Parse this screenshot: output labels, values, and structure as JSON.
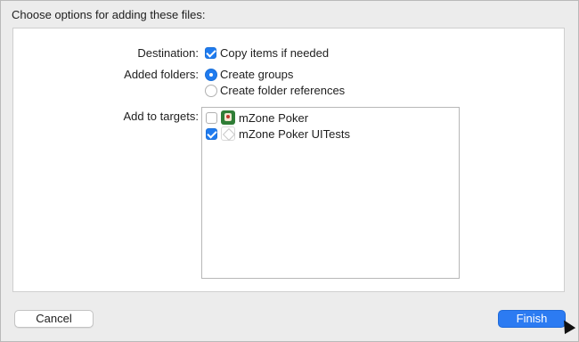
{
  "dialog": {
    "heading": "Choose options for adding these files:"
  },
  "options": {
    "destination": {
      "label": "Destination:",
      "checkbox_label": "Copy items if needed",
      "checked": true
    },
    "added_folders": {
      "label": "Added folders:",
      "choices": [
        {
          "label": "Create groups",
          "selected": true
        },
        {
          "label": "Create folder references",
          "selected": false
        }
      ]
    },
    "targets": {
      "label": "Add to targets:",
      "items": [
        {
          "name": "mZone Poker",
          "checked": false,
          "icon": "poker-app-icon"
        },
        {
          "name": "mZone Poker UITests",
          "checked": true,
          "icon": "test-bundle-icon"
        }
      ]
    }
  },
  "buttons": {
    "cancel": "Cancel",
    "finish": "Finish"
  },
  "colors": {
    "accent": "#1f7bef",
    "finish_button": "#2c7bf2",
    "background": "#ececec"
  }
}
